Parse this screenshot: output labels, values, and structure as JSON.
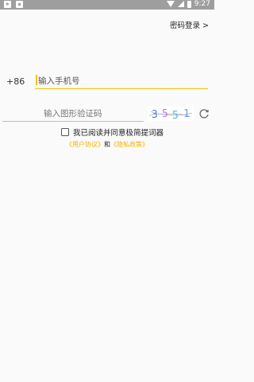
{
  "status_bar": {
    "time": "9:27",
    "left_icons": [
      "play-store-icon",
      "notification-icon"
    ],
    "right_icons": [
      "wifi-icon",
      "signal-icon",
      "battery-icon"
    ]
  },
  "header": {
    "password_login": "密码登录 >"
  },
  "phone": {
    "country_code": "+86",
    "placeholder": "输入手机号"
  },
  "captcha": {
    "placeholder": "输入图形验证码",
    "code": "3551"
  },
  "agreement": {
    "text": "我已阅读并同意极简提词器",
    "user_agreement": "《用户协议》",
    "and": "和",
    "privacy_policy": "《隐私政策》"
  },
  "colors": {
    "accent": "#f2c200",
    "link": "#f5b400",
    "status_bar": "#9e9e9e"
  }
}
